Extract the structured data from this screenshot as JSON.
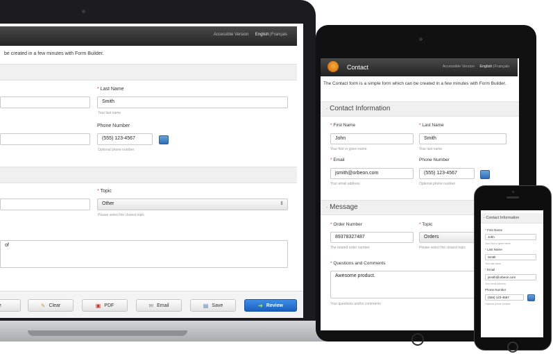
{
  "header": {
    "accessible_version": "Accessible Version",
    "english": "English",
    "separator": "|",
    "francais": "Français"
  },
  "form": {
    "title": "Contact",
    "intro": "The Contact form is a simple form which can be created in a few minutes with Form Builder.",
    "intro_fragment": "be created in a few minutes with Form Builder.",
    "sections": {
      "contact": "Contact Information",
      "message": "Message"
    },
    "fields": {
      "first_name": {
        "label": "First Name",
        "value": "John",
        "hint": "Your first or given name"
      },
      "last_name": {
        "label": "Last Name",
        "value": "Smith",
        "hint": "Your last name"
      },
      "email": {
        "label": "Email",
        "value": "jsmith@orbeon.com",
        "hint": "Your email address"
      },
      "phone": {
        "label": "Phone Number",
        "value": "(555) 123-4567",
        "hint": "Optional phone number"
      },
      "order_number": {
        "label": "Order Number",
        "value": "89378327487",
        "hint": "The related order number"
      },
      "topic": {
        "label": "Topic",
        "laptop_value": "Other",
        "tablet_value": "Orders",
        "hint": "Please select the closest topic"
      },
      "comments": {
        "label": "Questions and Comments",
        "value": "Awesome product.",
        "laptop_fragment": "of",
        "hint": "Your questions and/or comments"
      }
    },
    "required_mark": "*",
    "phone_section": "Contact Information"
  },
  "toolbar": {
    "buttons": [
      {
        "label": "e",
        "icon": "partial-icon"
      },
      {
        "label": "Clear",
        "icon": "clear-icon"
      },
      {
        "label": "PDF",
        "icon": "pdf-icon"
      },
      {
        "label": "Email",
        "icon": "email-icon"
      },
      {
        "label": "Save",
        "icon": "save-icon"
      },
      {
        "label": "Review",
        "icon": "review-arrow-icon"
      }
    ]
  },
  "colors": {
    "header_dark": "#2c2c2c",
    "primary_button": "#2a74d6",
    "required_star": "#dd3333",
    "logo_orange": "#e0831a"
  }
}
